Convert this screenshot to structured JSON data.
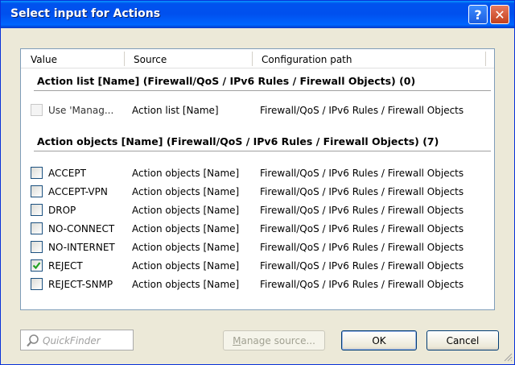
{
  "window": {
    "title": "Select input for Actions",
    "help_label": "?",
    "close_label": "✕"
  },
  "columns": {
    "value": "Value",
    "source": "Source",
    "path": "Configuration path"
  },
  "groups": [
    {
      "title": "Action list [Name] (Firewall/QoS / IPv6 Rules / Firewall Objects) (0)",
      "rows": [
        {
          "value": "Use 'Manag...",
          "source": "Action list [Name]",
          "path": "Firewall/QoS / IPv6 Rules / Firewall Objects",
          "checked": false,
          "disabled": true
        }
      ]
    },
    {
      "title": "Action objects [Name] (Firewall/QoS / IPv6 Rules / Firewall Objects) (7)",
      "rows": [
        {
          "value": "ACCEPT",
          "source": "Action objects [Name]",
          "path": "Firewall/QoS / IPv6 Rules / Firewall Objects",
          "checked": false
        },
        {
          "value": "ACCEPT-VPN",
          "source": "Action objects [Name]",
          "path": "Firewall/QoS / IPv6 Rules / Firewall Objects",
          "checked": false
        },
        {
          "value": "DROP",
          "source": "Action objects [Name]",
          "path": "Firewall/QoS / IPv6 Rules / Firewall Objects",
          "checked": false
        },
        {
          "value": "NO-CONNECT",
          "source": "Action objects [Name]",
          "path": "Firewall/QoS / IPv6 Rules / Firewall Objects",
          "checked": false
        },
        {
          "value": "NO-INTERNET",
          "source": "Action objects [Name]",
          "path": "Firewall/QoS / IPv6 Rules / Firewall Objects",
          "checked": false
        },
        {
          "value": "REJECT",
          "source": "Action objects [Name]",
          "path": "Firewall/QoS / IPv6 Rules / Firewall Objects",
          "checked": true
        },
        {
          "value": "REJECT-SNMP",
          "source": "Action objects [Name]",
          "path": "Firewall/QoS / IPv6 Rules / Firewall Objects",
          "checked": false
        }
      ]
    }
  ],
  "quickfinder": {
    "placeholder": "QuickFinder"
  },
  "buttons": {
    "manage_source_mnemonic": "M",
    "manage_source_rest": "anage source...",
    "ok": "OK",
    "cancel": "Cancel"
  },
  "colors": {
    "titlebar": "#0053ee",
    "dialog_bg": "#ece9d8",
    "checkmark": "#21a121"
  }
}
